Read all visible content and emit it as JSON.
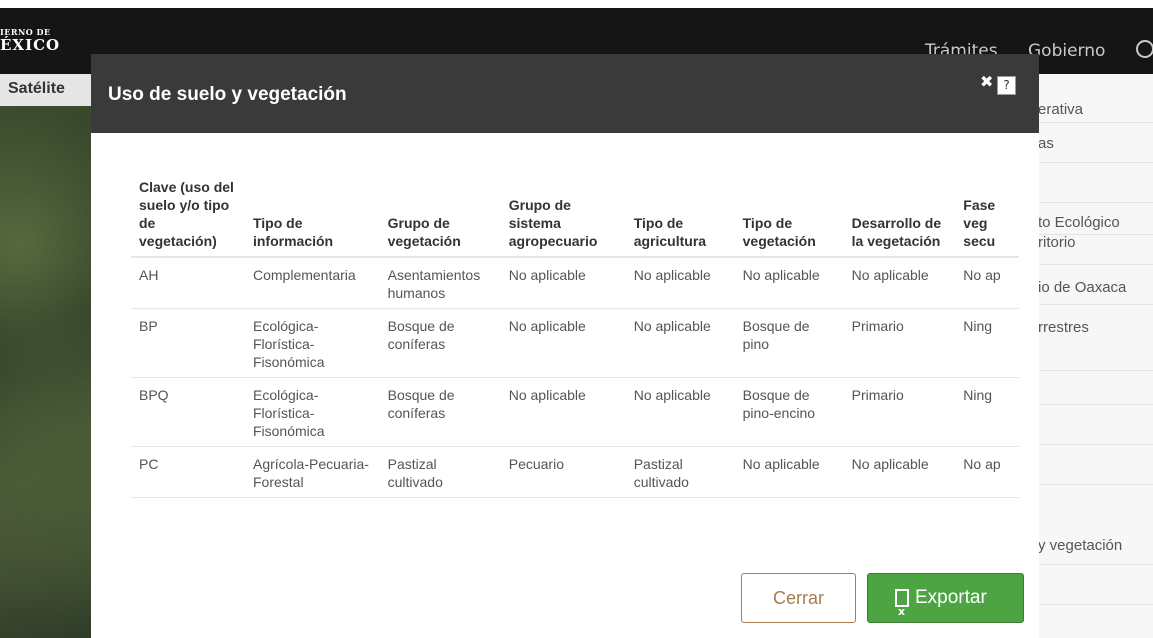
{
  "header": {
    "logo_line1": "IERNO DE",
    "logo_line2": "ÉXICO",
    "nav": [
      "Trámites",
      "Gobierno"
    ]
  },
  "map": {
    "tab_label": "Satélite"
  },
  "side_panel": {
    "items": [
      "erativa",
      "as",
      "",
      "to Ecológico",
      "ritorio",
      "io de Oaxaca",
      "rrestres",
      "",
      "",
      "",
      "y vegetación",
      ""
    ]
  },
  "modal": {
    "title": "Uso de suelo y vegetación",
    "close_glyph": "✖",
    "help_glyph": "?",
    "columns": [
      "Clave (uso del suelo y/o tipo de vegetación)",
      "Tipo de información",
      "Grupo de vegetación",
      "Grupo de sistema agropecuario",
      "Tipo de agricultura",
      "Tipo de vegetación",
      "Desarrollo de la vegetación",
      "Fase veg secu"
    ],
    "rows": [
      [
        "AH",
        "Complementaria",
        "Asentamientos humanos",
        "No aplicable",
        "No aplicable",
        "No aplicable",
        "No aplicable",
        "No ap"
      ],
      [
        "BP",
        "Ecológica-Florística-Fisonómica",
        "Bosque de coníferas",
        "No aplicable",
        "No aplicable",
        "Bosque de pino",
        "Primario",
        "Ning"
      ],
      [
        "BPQ",
        "Ecológica-Florística-Fisonómica",
        "Bosque de coníferas",
        "No aplicable",
        "No aplicable",
        "Bosque de pino-encino",
        "Primario",
        "Ning"
      ],
      [
        "PC",
        "Agrícola-Pecuaria-Forestal",
        "Pastizal cultivado",
        "Pecuario",
        "Pastizal cultivado",
        "No aplicable",
        "No aplicable",
        "No ap"
      ]
    ],
    "scroll": {
      "up": "^",
      "down": "⌄",
      "left": "<",
      "right": ">"
    },
    "buttons": {
      "cancel": "Cerrar",
      "export": "Exportar"
    },
    "colors": {
      "header_bg": "#3a3a3a",
      "export_bg": "#4ca443",
      "cancel_border": "#a67c52"
    }
  }
}
